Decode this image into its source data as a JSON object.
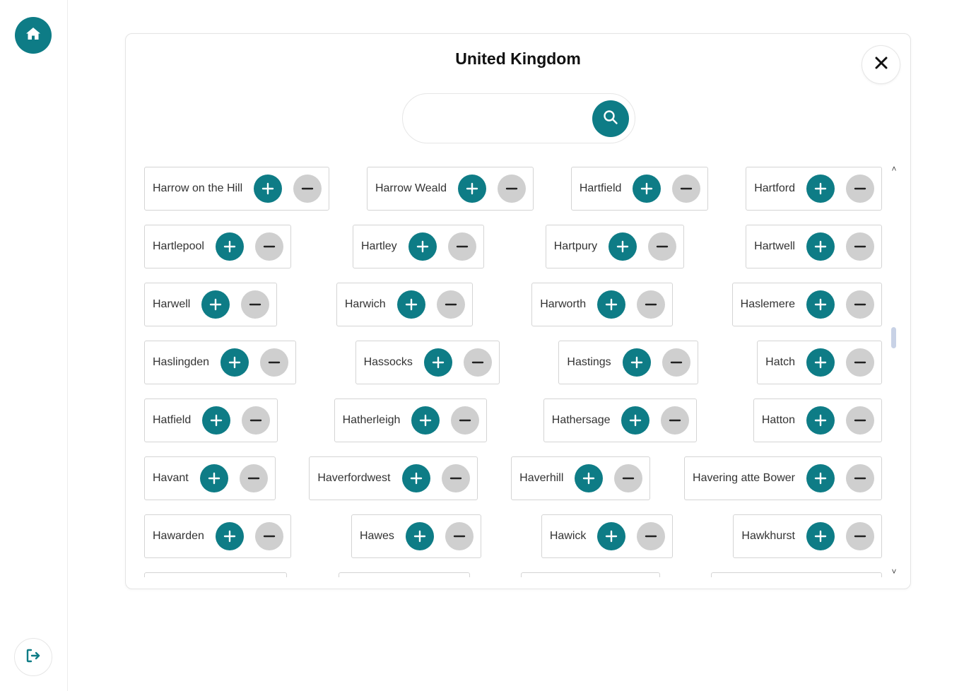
{
  "colors": {
    "accent": "#0e7c86",
    "minus": "#cfcfcf",
    "border": "#d4d4d4"
  },
  "sidebar": {
    "home_icon": "home-icon",
    "logout_icon": "logout-icon"
  },
  "modal": {
    "title": "United Kingdom",
    "close_icon": "close-icon",
    "search": {
      "value": "",
      "placeholder": "",
      "icon": "search-icon"
    }
  },
  "rows": [
    [
      "Harrow on the Hill",
      "Harrow Weald",
      "Hartfield",
      "Hartford"
    ],
    [
      "Hartlepool",
      "Hartley",
      "Hartpury",
      "Hartwell"
    ],
    [
      "Harwell",
      "Harwich",
      "Harworth",
      "Haslemere"
    ],
    [
      "Haslingden",
      "Hassocks",
      "Hastings",
      "Hatch"
    ],
    [
      "Hatfield",
      "Hatherleigh",
      "Hathersage",
      "Hatton"
    ],
    [
      "Havant",
      "Haverfordwest",
      "Haverhill",
      "Havering atte Bower"
    ],
    [
      "Hawarden",
      "Hawes",
      "Hawick",
      "Hawkhurst"
    ]
  ],
  "scrollbar": {
    "up_symbol": "˄",
    "down_symbol": "˅"
  }
}
